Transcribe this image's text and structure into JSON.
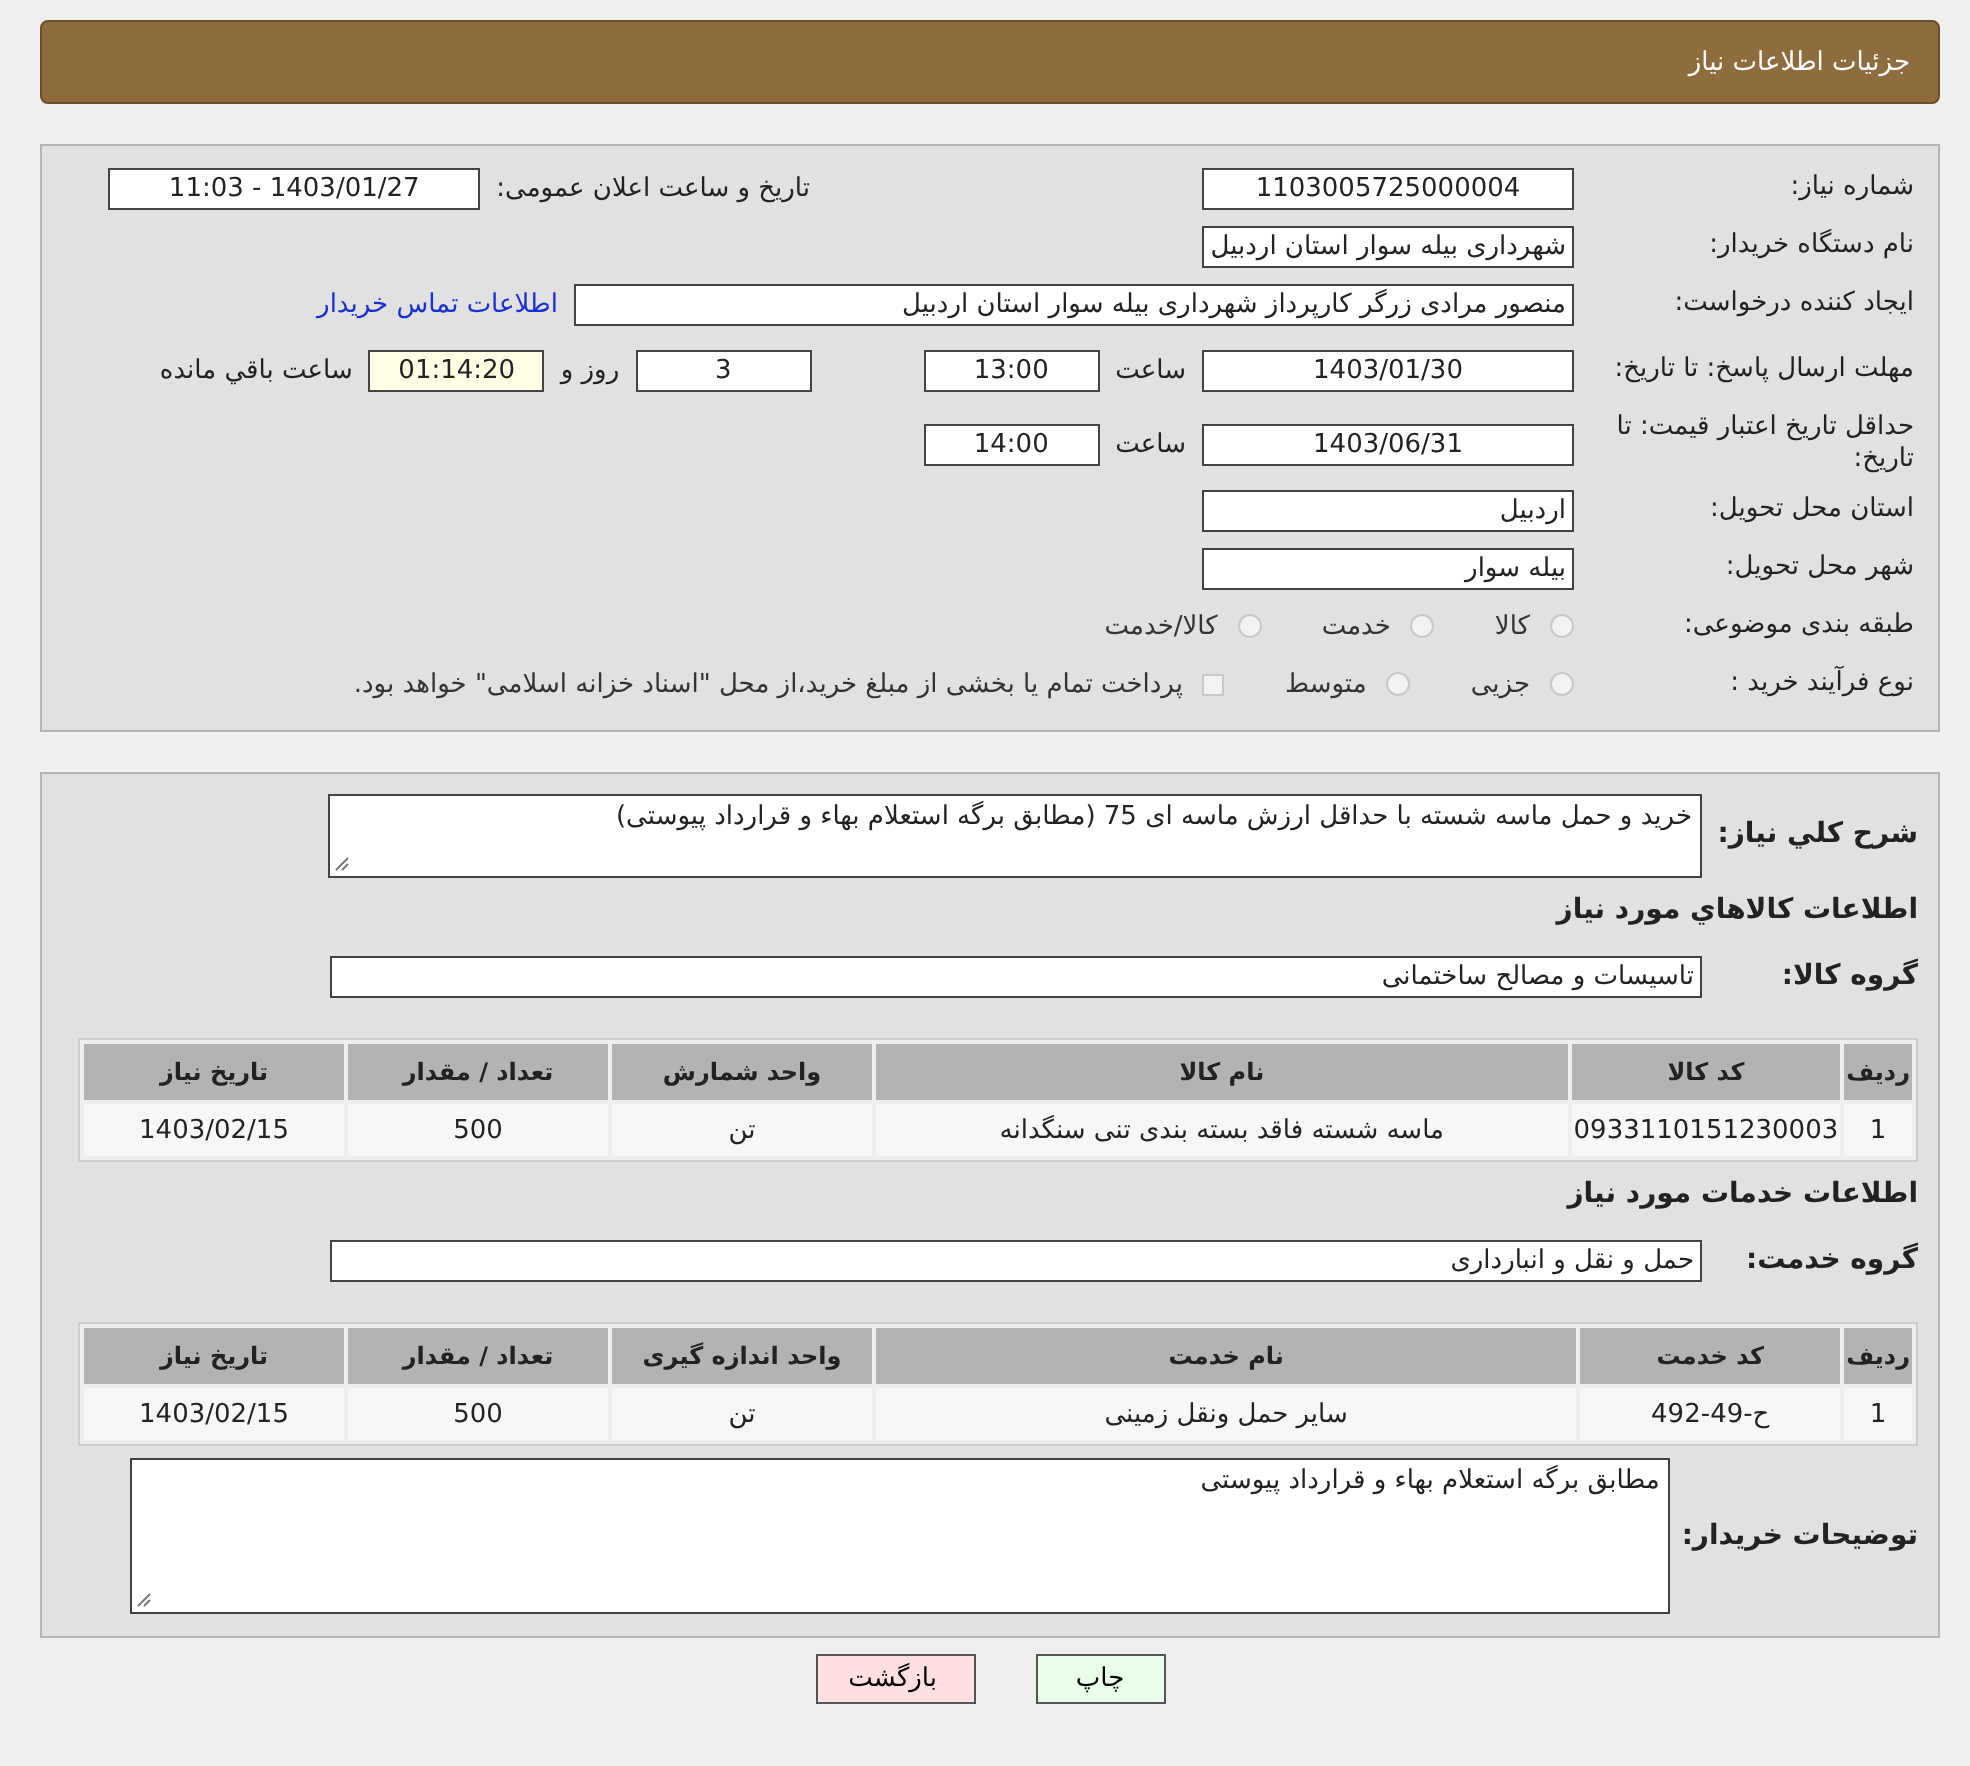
{
  "header": {
    "title": "جزئیات اطلاعات نیاز"
  },
  "details": {
    "need_number": {
      "label": "شماره نیاز:",
      "value": "1103005725000004"
    },
    "announce": {
      "label": "تاریخ و ساعت اعلان عمومی:",
      "value": "1403/01/27 - 11:03"
    },
    "buyer_org": {
      "label": "نام دستگاه خریدار:",
      "value": "شهرداری بیله سوار استان اردبیل"
    },
    "requester": {
      "label": "ایجاد کننده درخواست:",
      "value": "منصور مرادی زرگر کارپرداز شهرداری بیله سوار استان اردبیل",
      "link": "اطلاعات تماس خریدار"
    },
    "reply_deadline": {
      "label": "مهلت ارسال پاسخ: تا تاریخ:",
      "date": "1403/01/30",
      "time_label": "ساعت",
      "time": "13:00",
      "days": "3",
      "days_label": "روز و",
      "remaining": "01:14:20",
      "remaining_label": "ساعت باقي مانده"
    },
    "price_validity": {
      "label": "حداقل تاریخ اعتبار قیمت: تا تاریخ:",
      "date": "1403/06/31",
      "time_label": "ساعت",
      "time": "14:00"
    },
    "province": {
      "label": "استان محل تحویل:",
      "value": "اردبیل"
    },
    "city": {
      "label": "شهر محل تحویل:",
      "value": "بیله سوار"
    },
    "category": {
      "label": "طبقه بندی موضوعی:",
      "options": [
        {
          "kind": "radio",
          "label": "کالا",
          "selected": false
        },
        {
          "kind": "radio",
          "label": "خدمت",
          "selected": false
        },
        {
          "kind": "radio",
          "label": "کالا/خدمت",
          "selected": false
        }
      ]
    },
    "process": {
      "label": "نوع فرآیند خرید :",
      "options": [
        {
          "kind": "radio",
          "label": "جزیی",
          "selected": false
        },
        {
          "kind": "radio",
          "label": "متوسط",
          "selected": false
        },
        {
          "kind": "checkbox",
          "label": "پرداخت تمام یا بخشی از مبلغ خرید،از محل \"اسناد خزانه اسلامی\" خواهد بود.",
          "checked": false
        }
      ]
    }
  },
  "description": {
    "label": "شرح کلي نياز:",
    "value": "خرید و حمل ماسه شسته با حداقل ارزش ماسه ای 75 (مطابق برگه استعلام بهاء و قرارداد پیوستی)"
  },
  "goods": {
    "heading": "اطلاعات کالاهاي مورد نياز",
    "group_label": "گروه کالا:",
    "group": "تاسیسات و مصالح ساختمانی",
    "table": {
      "columns": [
        "ردیف",
        "کد کالا",
        "نام کالا",
        "واحد شمارش",
        "تعداد / مقدار",
        "تاریخ نیاز"
      ],
      "rows": [
        [
          "1",
          "0933110151230003",
          "ماسه شسته فاقد بسته بندی تنی سنگدانه",
          "تن",
          "500",
          "1403/02/15"
        ]
      ]
    }
  },
  "services": {
    "heading": "اطلاعات خدمات مورد نیاز",
    "group_label": "گروه خدمت:",
    "group": "حمل و نقل و انبارداری",
    "table": {
      "columns": [
        "ردیف",
        "کد خدمت",
        "نام خدمت",
        "واحد اندازه گیری",
        "تعداد / مقدار",
        "تاریخ نیاز"
      ],
      "rows": [
        [
          "1",
          "ح-49-492",
          "سایر حمل ونقل زمینی",
          "تن",
          "500",
          "1403/02/15"
        ]
      ]
    }
  },
  "buyer_notes": {
    "label": "توضیحات خریدار:",
    "value": "مطابق برگه استعلام بهاء و قرارداد پیوستی"
  },
  "buttons": [
    {
      "kind": "print",
      "label": "چاپ"
    },
    {
      "kind": "back",
      "label": "بازگشت"
    }
  ]
}
